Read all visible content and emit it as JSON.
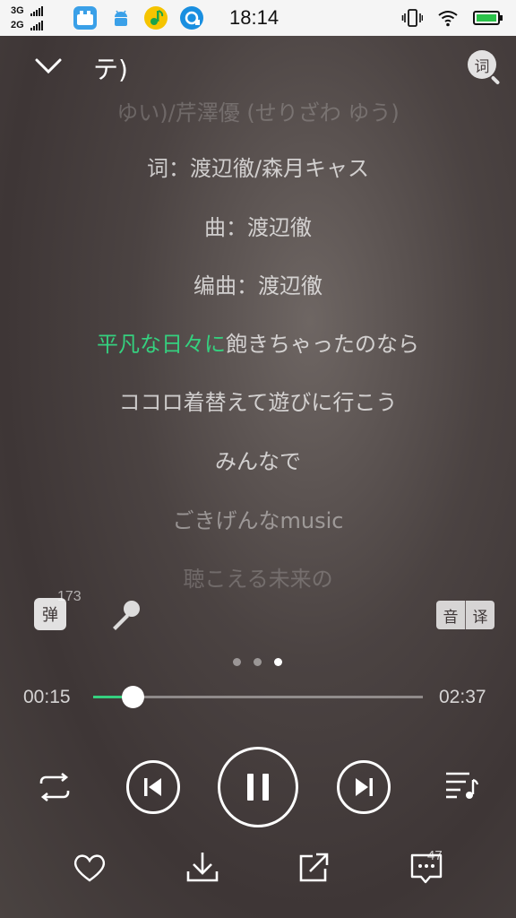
{
  "status_bar": {
    "network_1": "3G",
    "network_2": "2G",
    "time": "18:14",
    "apps": [
      "vivo-app-icon",
      "android-icon",
      "qq-music-icon",
      "music-player-icon"
    ]
  },
  "header": {
    "title": "テ)",
    "lyric_search_label": "词"
  },
  "lyrics": {
    "lines": [
      {
        "text": "ゆい)/芹澤優 (せりざわ ゆう)",
        "state": "faded"
      },
      {
        "text": "词：渡辺徹/森月キャス",
        "state": "normal"
      },
      {
        "text": "曲：渡辺徹",
        "state": "normal"
      },
      {
        "text": "编曲：渡辺徹",
        "state": "normal"
      },
      {
        "sung": "平凡な日々に",
        "rest": "飽きちゃったのなら",
        "state": "current"
      },
      {
        "text": "ココロ着替えて遊びに行こう",
        "state": "normal"
      },
      {
        "text": "みんなで",
        "state": "normal"
      },
      {
        "text": "ごきげんなmusic",
        "state": "faded"
      },
      {
        "text": "聴こえる未来の",
        "state": "faded"
      }
    ],
    "highlight_color": "#35d07f"
  },
  "tools": {
    "danmaku_label": "弹",
    "danmaku_count": "173",
    "pronunciation_label": "音",
    "translation_label": "译"
  },
  "pager": {
    "pages": 3,
    "active": 3
  },
  "progress": {
    "current": "00:15",
    "total": "02:37",
    "fraction": 0.12
  },
  "bottom": {
    "comment_count": "47"
  },
  "colors": {
    "accent": "#35d07f"
  }
}
